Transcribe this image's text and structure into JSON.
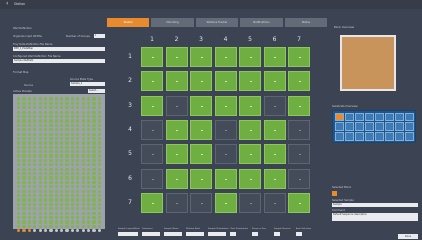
{
  "window": {
    "title": "Station",
    "back_icon": "chevron-left-icon"
  },
  "left": {
    "well_definition_label": "Well Definition",
    "organize_label": "Organize Input Widths",
    "num_groups_label": "Number of Groups",
    "num_groups_value": "1",
    "input_field_label": "Tray Data Definition File Name",
    "input_field_value": "IMM_1_PlateMap",
    "plate_label": "Configured Well Definition File Name",
    "plate_value": "Sample WellDefs",
    "format_label": "Format Map",
    "source_label": "Source Plate Type",
    "source_option": "Source",
    "source_value": "Sample_1",
    "active_label": "Active Pockets",
    "active_value": "Select..."
  },
  "tabs": [
    {
      "label": "Station",
      "active": true
    },
    {
      "label": "Mounting",
      "active": false
    },
    {
      "label": "Stations Tracker",
      "active": false
    },
    {
      "label": "Notifications",
      "active": false
    },
    {
      "label": "Status",
      "active": false
    }
  ],
  "grid": {
    "columns": [
      "1",
      "2",
      "3",
      "4",
      "5",
      "6",
      "7"
    ],
    "rows": [
      "1",
      "2",
      "3",
      "4",
      "5",
      "6",
      "7"
    ],
    "cells": [
      [
        1,
        1,
        1,
        1,
        1,
        1,
        1
      ],
      [
        1,
        1,
        1,
        1,
        1,
        1,
        1
      ],
      [
        1,
        0,
        1,
        1,
        1,
        0,
        1
      ],
      [
        0,
        1,
        1,
        0,
        1,
        1,
        0
      ],
      [
        0,
        1,
        1,
        0,
        1,
        1,
        0
      ],
      [
        0,
        1,
        1,
        1,
        1,
        1,
        0
      ],
      [
        1,
        0,
        0,
        1,
        0,
        0,
        1
      ]
    ]
  },
  "bottom": {
    "fields": [
      "Sample Layout/Ratio",
      "Treatment",
      "Sample Name",
      "Dilution Ratio",
      "Sample Distribution"
    ],
    "checks": [
      "Clear Destination",
      "Preserve Prev",
      "Sample Reserve",
      "Auto Selection"
    ]
  },
  "right": {
    "overview_label": "Block Overview",
    "frame_label": "Substrate Overview",
    "selected_label": "Selected Block",
    "selected_name_label": "Selected Sample",
    "selected_name_value": "Sample",
    "comment_label": "Comment",
    "comment_value": "Default Sequence description",
    "ok_label": "Done"
  }
}
